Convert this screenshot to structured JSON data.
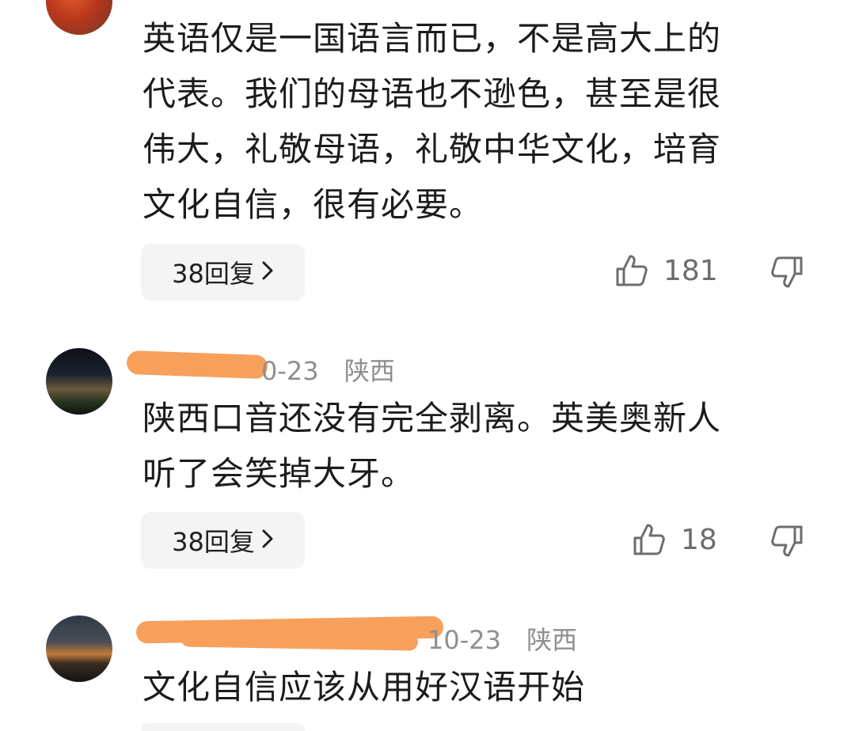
{
  "comments": [
    {
      "text_lines": [
        "英语仅是一国语言而已，不是高大上的",
        "代表。我们的母语也不逊色，甚至是很",
        "伟大，礼敬母语，礼敬中华文化，培育",
        "文化自信，很有必要。"
      ],
      "reply_label": "38回复",
      "like_count": "181"
    },
    {
      "date": "0-23",
      "region": "陕西",
      "text_lines": [
        "陕西口音还没有完全剥离。英美奥新人",
        "听了会笑掉大牙。"
      ],
      "reply_label": "38回复",
      "like_count": "18"
    },
    {
      "date": "10-23",
      "region": "陕西",
      "text_lines": [
        "文化自信应该从用好汉语开始"
      ]
    }
  ],
  "colors": {
    "text": "#1c1c1c",
    "meta": "#8f8f8f",
    "reply_bg": "#f4f4f4",
    "redaction": "#f7a05b"
  },
  "icons": [
    "thumbs-up-icon",
    "thumbs-down-icon",
    "chevron-right-icon"
  ]
}
